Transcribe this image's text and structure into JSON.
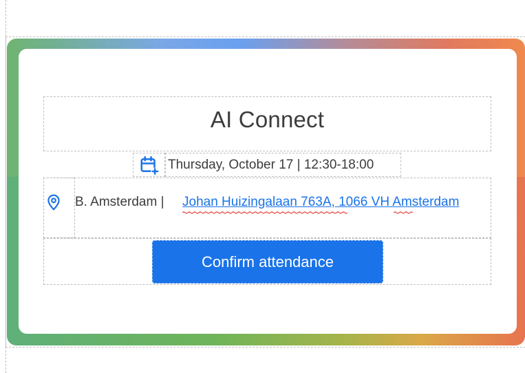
{
  "event": {
    "title": "AI Connect",
    "date_time": "Thursday, October 17  | 12:30-18:00",
    "location_name": "B. Amsterdam | ",
    "location_address": "Johan Huizingalaan 763A, 1066 VH Amsterdam"
  },
  "actions": {
    "confirm_label": "Confirm attendance"
  },
  "icons": {
    "calendar": "calendar-add-icon",
    "location": "location-pin-icon"
  },
  "colors": {
    "accent": "#1a73e8",
    "text": "#3c3c3c",
    "spellcheck": "#e53935"
  }
}
